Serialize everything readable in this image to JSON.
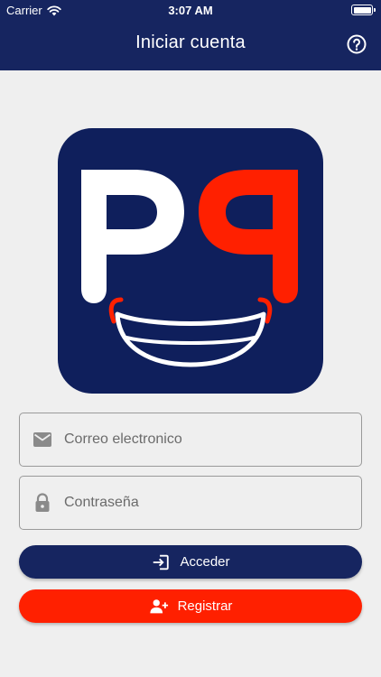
{
  "status_bar": {
    "carrier": "Carrier",
    "time": "3:07 AM"
  },
  "nav": {
    "title": "Iniciar cuenta",
    "help_icon": "help-circle-icon"
  },
  "logo": {
    "text": "PP"
  },
  "form": {
    "email": {
      "placeholder": "Correo electronico",
      "value": "",
      "icon": "mail-icon"
    },
    "password": {
      "placeholder": "Contraseña",
      "value": "",
      "icon": "lock-icon"
    }
  },
  "buttons": {
    "login_label": "Acceder",
    "register_label": "Registrar"
  },
  "colors": {
    "navy": "#162560",
    "red": "#ff2000",
    "background": "#efefef"
  }
}
